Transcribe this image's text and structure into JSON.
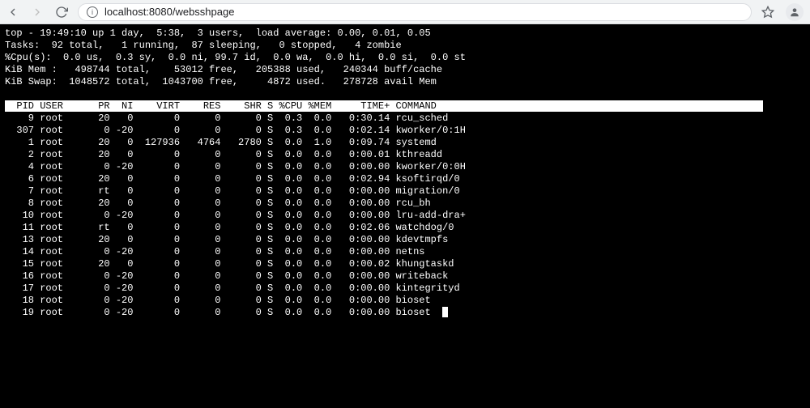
{
  "browser": {
    "url": "localhost:8080/websshpage"
  },
  "top": {
    "summary_lines": [
      "top - 19:49:10 up 1 day,  5:38,  3 users,  load average: 0.00, 0.01, 0.05",
      "Tasks:  92 total,   1 running,  87 sleeping,   0 stopped,   4 zombie",
      "%Cpu(s):  0.0 us,  0.3 sy,  0.0 ni, 99.7 id,  0.0 wa,  0.0 hi,  0.0 si,  0.0 st",
      "KiB Mem :   498744 total,    53012 free,   205388 used,   240344 buff/cache",
      "KiB Swap:  1048572 total,  1043700 free,     4872 used.   278728 avail Mem"
    ],
    "columns": [
      "PID",
      "USER",
      "PR",
      "NI",
      "VIRT",
      "RES",
      "SHR",
      "S",
      "%CPU",
      "%MEM",
      "TIME+",
      "COMMAND"
    ],
    "rows": [
      {
        "pid": "9",
        "user": "root",
        "pr": "20",
        "ni": "0",
        "virt": "0",
        "res": "0",
        "shr": "0",
        "s": "S",
        "cpu": "0.3",
        "mem": "0.0",
        "time": "0:30.14",
        "cmd": "rcu_sched"
      },
      {
        "pid": "307",
        "user": "root",
        "pr": "0",
        "ni": "-20",
        "virt": "0",
        "res": "0",
        "shr": "0",
        "s": "S",
        "cpu": "0.3",
        "mem": "0.0",
        "time": "0:02.14",
        "cmd": "kworker/0:1H"
      },
      {
        "pid": "1",
        "user": "root",
        "pr": "20",
        "ni": "0",
        "virt": "127936",
        "res": "4764",
        "shr": "2780",
        "s": "S",
        "cpu": "0.0",
        "mem": "1.0",
        "time": "0:09.74",
        "cmd": "systemd"
      },
      {
        "pid": "2",
        "user": "root",
        "pr": "20",
        "ni": "0",
        "virt": "0",
        "res": "0",
        "shr": "0",
        "s": "S",
        "cpu": "0.0",
        "mem": "0.0",
        "time": "0:00.01",
        "cmd": "kthreadd"
      },
      {
        "pid": "4",
        "user": "root",
        "pr": "0",
        "ni": "-20",
        "virt": "0",
        "res": "0",
        "shr": "0",
        "s": "S",
        "cpu": "0.0",
        "mem": "0.0",
        "time": "0:00.00",
        "cmd": "kworker/0:0H"
      },
      {
        "pid": "6",
        "user": "root",
        "pr": "20",
        "ni": "0",
        "virt": "0",
        "res": "0",
        "shr": "0",
        "s": "S",
        "cpu": "0.0",
        "mem": "0.0",
        "time": "0:02.94",
        "cmd": "ksoftirqd/0"
      },
      {
        "pid": "7",
        "user": "root",
        "pr": "rt",
        "ni": "0",
        "virt": "0",
        "res": "0",
        "shr": "0",
        "s": "S",
        "cpu": "0.0",
        "mem": "0.0",
        "time": "0:00.00",
        "cmd": "migration/0"
      },
      {
        "pid": "8",
        "user": "root",
        "pr": "20",
        "ni": "0",
        "virt": "0",
        "res": "0",
        "shr": "0",
        "s": "S",
        "cpu": "0.0",
        "mem": "0.0",
        "time": "0:00.00",
        "cmd": "rcu_bh"
      },
      {
        "pid": "10",
        "user": "root",
        "pr": "0",
        "ni": "-20",
        "virt": "0",
        "res": "0",
        "shr": "0",
        "s": "S",
        "cpu": "0.0",
        "mem": "0.0",
        "time": "0:00.00",
        "cmd": "lru-add-dra+"
      },
      {
        "pid": "11",
        "user": "root",
        "pr": "rt",
        "ni": "0",
        "virt": "0",
        "res": "0",
        "shr": "0",
        "s": "S",
        "cpu": "0.0",
        "mem": "0.0",
        "time": "0:02.06",
        "cmd": "watchdog/0"
      },
      {
        "pid": "13",
        "user": "root",
        "pr": "20",
        "ni": "0",
        "virt": "0",
        "res": "0",
        "shr": "0",
        "s": "S",
        "cpu": "0.0",
        "mem": "0.0",
        "time": "0:00.00",
        "cmd": "kdevtmpfs"
      },
      {
        "pid": "14",
        "user": "root",
        "pr": "0",
        "ni": "-20",
        "virt": "0",
        "res": "0",
        "shr": "0",
        "s": "S",
        "cpu": "0.0",
        "mem": "0.0",
        "time": "0:00.00",
        "cmd": "netns"
      },
      {
        "pid": "15",
        "user": "root",
        "pr": "20",
        "ni": "0",
        "virt": "0",
        "res": "0",
        "shr": "0",
        "s": "S",
        "cpu": "0.0",
        "mem": "0.0",
        "time": "0:00.02",
        "cmd": "khungtaskd"
      },
      {
        "pid": "16",
        "user": "root",
        "pr": "0",
        "ni": "-20",
        "virt": "0",
        "res": "0",
        "shr": "0",
        "s": "S",
        "cpu": "0.0",
        "mem": "0.0",
        "time": "0:00.00",
        "cmd": "writeback"
      },
      {
        "pid": "17",
        "user": "root",
        "pr": "0",
        "ni": "-20",
        "virt": "0",
        "res": "0",
        "shr": "0",
        "s": "S",
        "cpu": "0.0",
        "mem": "0.0",
        "time": "0:00.00",
        "cmd": "kintegrityd"
      },
      {
        "pid": "18",
        "user": "root",
        "pr": "0",
        "ni": "-20",
        "virt": "0",
        "res": "0",
        "shr": "0",
        "s": "S",
        "cpu": "0.0",
        "mem": "0.0",
        "time": "0:00.00",
        "cmd": "bioset"
      },
      {
        "pid": "19",
        "user": "root",
        "pr": "0",
        "ni": "-20",
        "virt": "0",
        "res": "0",
        "shr": "0",
        "s": "S",
        "cpu": "0.0",
        "mem": "0.0",
        "time": "0:00.00",
        "cmd": "bioset"
      }
    ]
  }
}
